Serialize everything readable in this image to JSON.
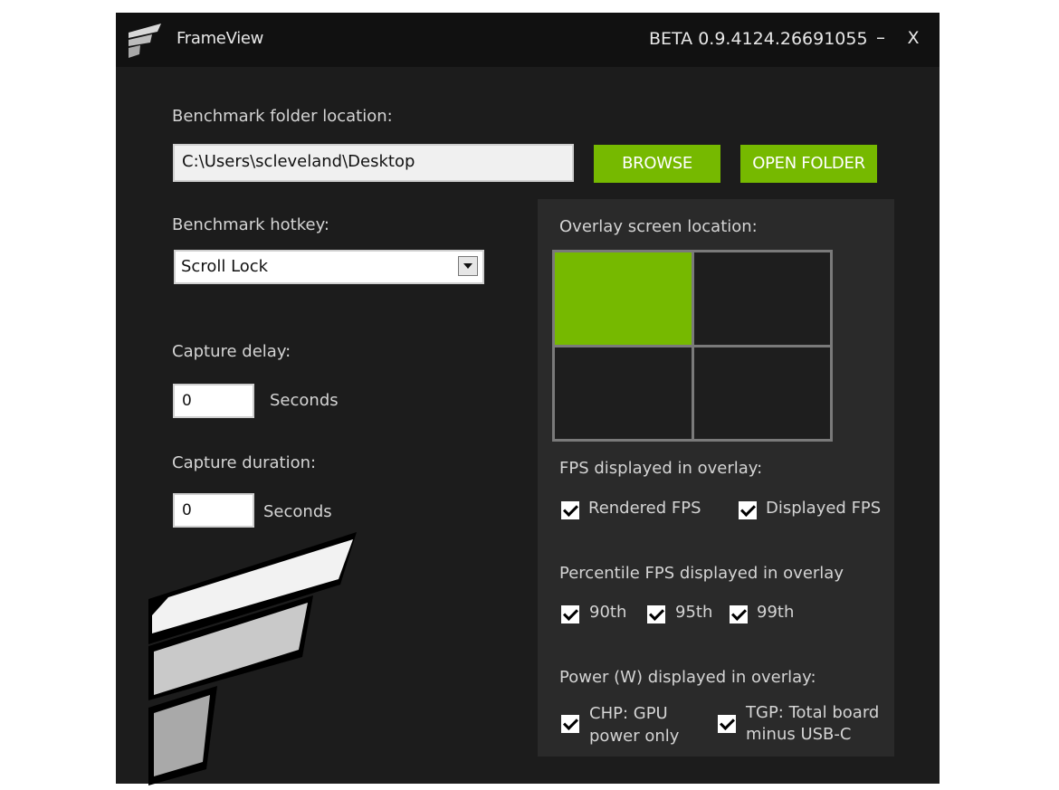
{
  "titlebar": {
    "app_title": "FrameView",
    "version": "BETA 0.9.4124.26691055",
    "minimize_glyph": "–",
    "close_glyph": "X"
  },
  "benchmark_folder": {
    "label": "Benchmark folder location:",
    "value": "C:\\Users\\scleveland\\Desktop",
    "browse_label": "BROWSE",
    "open_folder_label": "OPEN FOLDER"
  },
  "hotkey": {
    "label": "Benchmark hotkey:",
    "selected": "Scroll Lock"
  },
  "capture_delay": {
    "label": "Capture delay:",
    "value": "0",
    "unit": "Seconds"
  },
  "capture_duration": {
    "label": "Capture duration:",
    "value": "0",
    "unit": "Seconds"
  },
  "overlay": {
    "location_label": "Overlay screen location:",
    "selected_position": "top-left",
    "fps_label": "FPS displayed in overlay:",
    "fps_options": [
      {
        "label": "Rendered FPS",
        "checked": true
      },
      {
        "label": "Displayed FPS",
        "checked": true
      }
    ],
    "percentile_label": "Percentile FPS displayed in overlay",
    "percentile_options": [
      {
        "label": "90th",
        "checked": true
      },
      {
        "label": "95th",
        "checked": true
      },
      {
        "label": "99th",
        "checked": true
      }
    ],
    "power_label": "Power (W) displayed in overlay:",
    "power_options": [
      {
        "line1": "CHP: GPU",
        "line2": "power only",
        "checked": true
      },
      {
        "line1": "TGP: Total board",
        "line2": "minus USB-C",
        "checked": true
      }
    ]
  },
  "colors": {
    "accent": "#76b900",
    "window_bg": "#1c1c1c",
    "panel_bg": "#2a2a2a",
    "titlebar_bg": "#111111"
  },
  "icons": {
    "app": "frameview-logo-icon",
    "dropdown": "chevron-down-icon",
    "checkbox": "checkmark-icon"
  }
}
